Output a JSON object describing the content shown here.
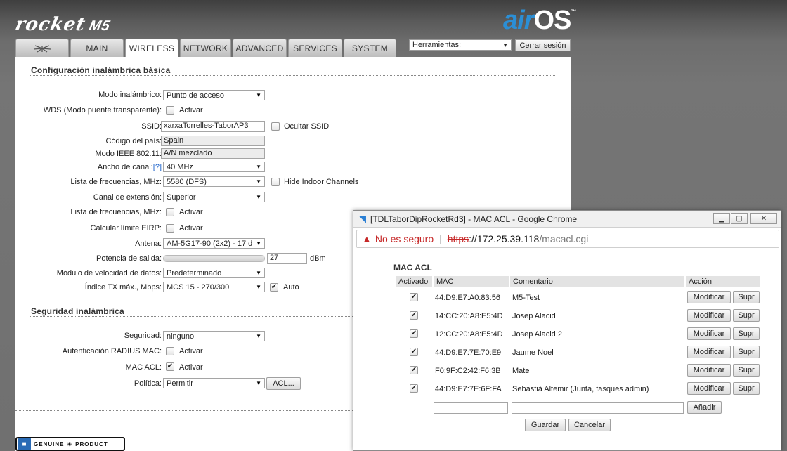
{
  "branding": {
    "product": "rocket",
    "model": "M5",
    "os_air": "air",
    "os_os": "OS",
    "tm": "™",
    "genuine": "GENUINE",
    "product_word": "PRODUCT"
  },
  "tabs": [
    {
      "label": "MAIN"
    },
    {
      "label": "WIRELESS"
    },
    {
      "label": "NETWORK"
    },
    {
      "label": "ADVANCED"
    },
    {
      "label": "SERVICES"
    },
    {
      "label": "SYSTEM"
    }
  ],
  "tools": {
    "label": "Herramientas:",
    "logout": "Cerrar sesión"
  },
  "basic": {
    "title": "Configuración inalámbrica básica",
    "mode_label": "Modo inalámbrico:",
    "mode_value": "Punto de acceso",
    "wds_label": "WDS (Modo puente transparente):",
    "wds_cb": "Activar",
    "ssid_label": "SSID:",
    "ssid_value": "xarxaTorrelles-TaborAP3",
    "hide_ssid": "Ocultar SSID",
    "country_label": "Código del país:",
    "country_value": "Spain",
    "ieee_label": "Modo IEEE 802.11:",
    "ieee_value": "A/N mezclado",
    "width_label": "Ancho de canal:",
    "width_help": "[?]",
    "width_value": "40 MHz",
    "freq_label": "Lista de frecuencias, MHz:",
    "freq_value": "5580 (DFS)",
    "hide_indoor": "Hide Indoor Channels",
    "ext_label": "Canal de extensión:",
    "ext_value": "Superior",
    "freq2_label": "Lista de frecuencias, MHz:",
    "freq2_cb": "Activar",
    "eirp_label": "Calcular límite EIRP:",
    "eirp_cb": "Activar",
    "antenna_label": "Antena:",
    "antenna_value": "AM-5G17-90 (2x2) - 17 d",
    "power_label": "Potencia de salida:",
    "power_value": "27",
    "power_unit": "dBm",
    "rate_label": "Módulo de velocidad de datos:",
    "rate_value": "Predeterminado",
    "txidx_label": "Índice TX máx., Mbps:",
    "txidx_value": "MCS 15 - 270/300",
    "auto": "Auto"
  },
  "security": {
    "title": "Seguridad inalámbrica",
    "sec_label": "Seguridad:",
    "sec_value": "ninguno",
    "radius_label": "Autenticación RADIUS MAC:",
    "radius_cb": "Activar",
    "macacl_label": "MAC ACL:",
    "macacl_cb": "Activar",
    "policy_label": "Política:",
    "policy_value": "Permitir",
    "acl_btn": "ACL..."
  },
  "popup": {
    "title": "[TDLTaborDipRocketRd3] - MAC ACL - Google Chrome",
    "not_secure": "No es seguro",
    "scheme": "https",
    "sep": "://",
    "host": "172.25.39.118",
    "path": "/macacl.cgi",
    "heading": "MAC ACL",
    "cols": {
      "enabled": "Activado",
      "mac": "MAC",
      "comment": "Comentario",
      "action": "Acción"
    },
    "rows": [
      {
        "mac": "44:D9:E7:A0:83:56",
        "comment": "M5-Test"
      },
      {
        "mac": "14:CC:20:A8:E5:4D",
        "comment": "Josep Alacid"
      },
      {
        "mac": "12:CC:20:A8:E5:4D",
        "comment": "Josep Alacid 2"
      },
      {
        "mac": "44:D9:E7:7E:70:E9",
        "comment": "Jaume Noel"
      },
      {
        "mac": "F0:9F:C2:42:F6:3B",
        "comment": "Mate"
      },
      {
        "mac": "44:D9:E7:7E:6F:FA",
        "comment": "Sebastià Altemir (Junta, tasques admin)"
      }
    ],
    "modify": "Modificar",
    "delete": "Supr",
    "add": "Añadir",
    "save": "Guardar",
    "cancel": "Cancelar"
  },
  "colors": {
    "accent": "#2b8fd6",
    "warning": "#c62828"
  }
}
